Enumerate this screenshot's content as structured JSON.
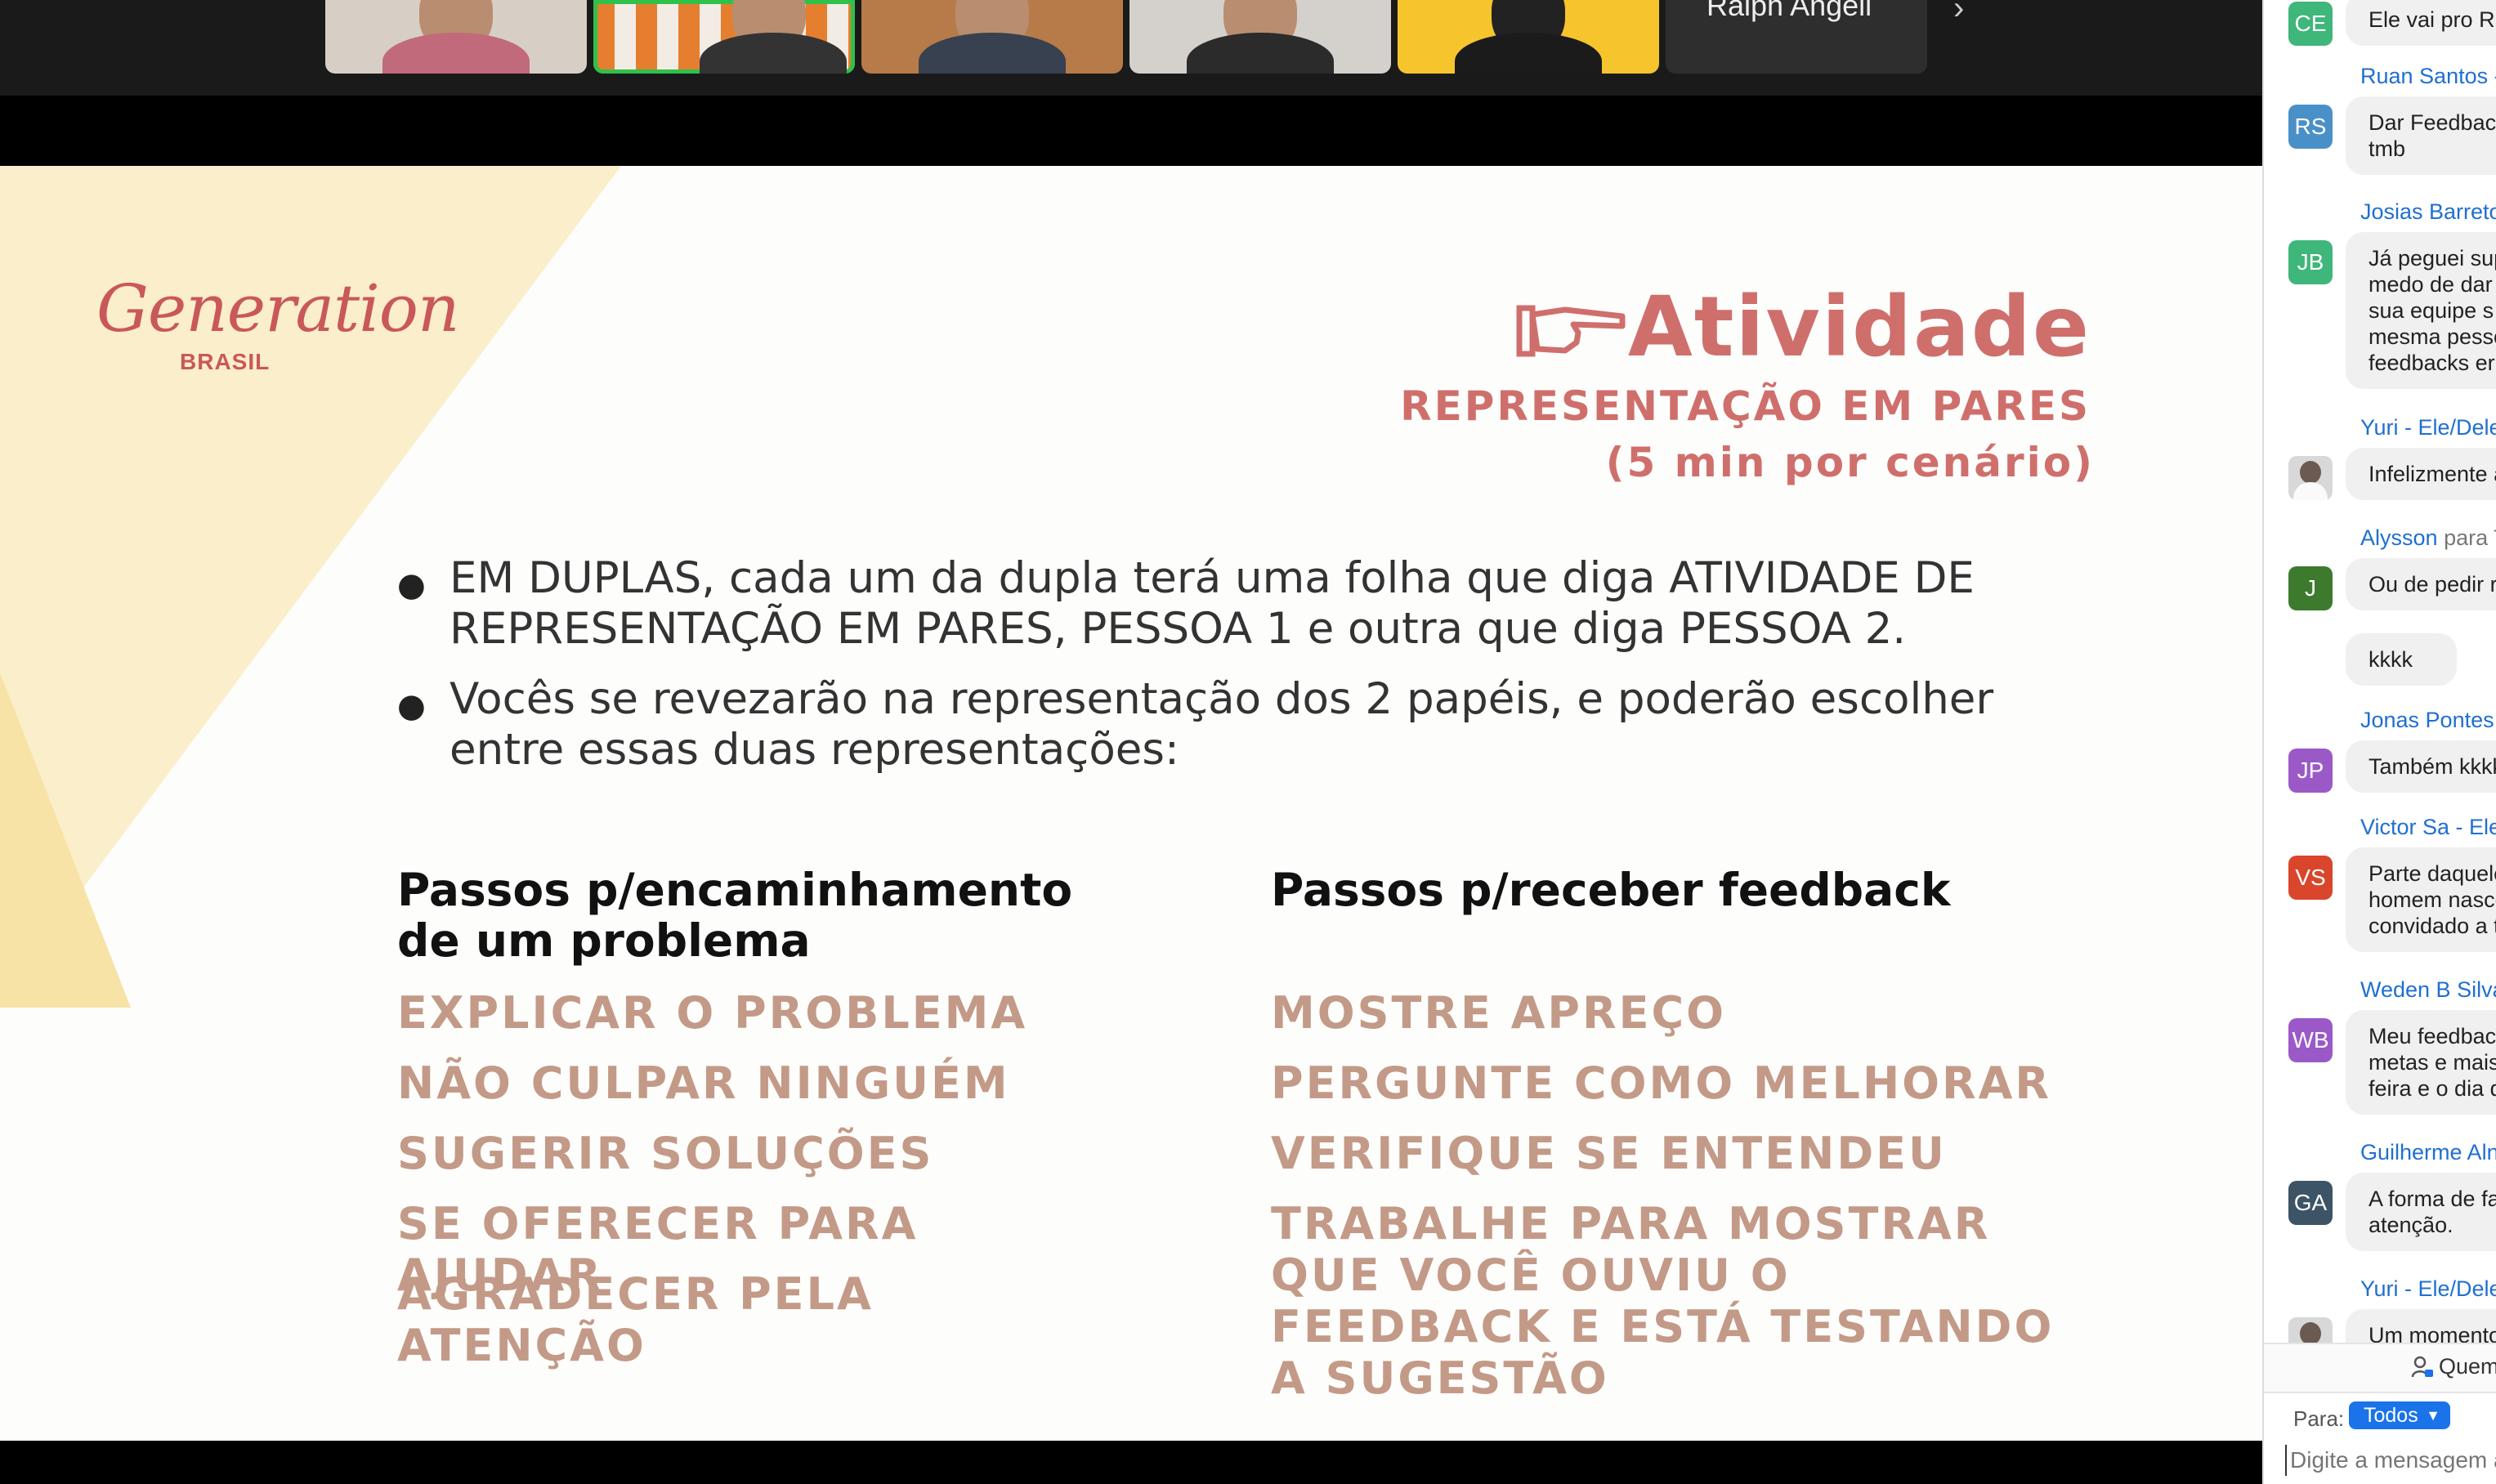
{
  "participants": {
    "tiles": [
      {
        "name": "participant-1"
      },
      {
        "name": "participant-2",
        "active": true
      },
      {
        "name": "participant-3"
      },
      {
        "name": "participant-4"
      },
      {
        "name": "participant-5"
      }
    ],
    "name_tile": "Ralph Angeli"
  },
  "slide": {
    "logo": "Generation",
    "logo_sub": "BRASIL",
    "title": "Atividade",
    "subtitle": "REPRESENTAÇÃO EM PARES",
    "duration": "(5 min por cenário)",
    "bullets": [
      "EM DUPLAS, cada um da dupla terá uma folha que diga ATIVIDADE DE REPRESENTAÇÃO EM PARES, PESSOA 1 e outra que diga  PESSOA 2.",
      "Vocês se revezarão na representação dos 2 papéis, e poderão escolher entre essas duas representações:"
    ],
    "column1": {
      "heading": "Passos p/encaminhamento de um problema",
      "steps": [
        "EXPLICAR O PROBLEMA",
        "NÃO CULPAR NINGUÉM",
        "SUGERIR SOLUÇÕES",
        "SE OFERECER PARA AJUDAR",
        "AGRADECER PELA ATENÇÃO"
      ]
    },
    "column2": {
      "heading": "Passos p/receber feedback",
      "steps": [
        "MOSTRE APREÇO",
        "PERGUNTE COMO MELHORAR",
        "VERIFIQUE SE ENTENDEU",
        "TRABALHE PARA MOSTRAR QUE VOCÊ OUVIU O FEEDBACK E ESTÁ TESTANDO A SUGESTÃO"
      ]
    }
  },
  "chat": {
    "messages": [
      {
        "sender": "",
        "initials": "CE",
        "color": "#3fb67a",
        "text": "Ele vai pro RH"
      },
      {
        "sender": "Ruan Santos -",
        "initials": "RS",
        "color": "#4a90c8",
        "text": "Dar Feedback\ntmb"
      },
      {
        "sender": "Josias Barreto",
        "initials": "JB",
        "color": "#3fb67a",
        "text": "Já peguei sup\nmedo de dar\nsua equipe s\nmesma pesso\nfeedbacks er"
      },
      {
        "sender": "Yuri - Ele/Dele",
        "initials": "",
        "color": "",
        "text": "Infelizmente a"
      },
      {
        "sender": "Alysson",
        "para": "para T",
        "initials": "J",
        "color": "#3d7a2e",
        "text": "Ou de pedir r"
      },
      {
        "sender": "",
        "initials": "",
        "color": "",
        "text": "kkkk"
      },
      {
        "sender": "Jonas Pontes",
        "initials": "JP",
        "color": "#9b59c8",
        "text": "Também kkkk"
      },
      {
        "sender": "Victor Sa - Ele",
        "initials": "VS",
        "color": "#d9462b",
        "text": "Parte daquele\nhomem nasce\nconvidado a t"
      },
      {
        "sender": "Weden B Silva",
        "initials": "WB",
        "color": "#9b59c8",
        "text": "Meu feedbac\nmetas e mais\nfeira e o dia d"
      },
      {
        "sender": "Guilherme Aln",
        "initials": "GA",
        "color": "#3d5366",
        "text": "A forma de fa\natenção."
      },
      {
        "sender": "Yuri - Ele/Dele",
        "initials": "",
        "color": "",
        "text": "Um momento"
      }
    ],
    "who_can_see": "Quem",
    "to_label": "Para:",
    "to_value": "Todos",
    "input_placeholder": "Digite a mensagem aqui..."
  }
}
